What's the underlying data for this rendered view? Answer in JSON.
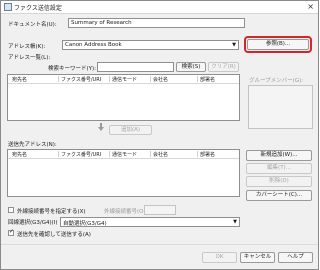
{
  "window": {
    "title": "ファクス送信設定"
  },
  "doc_name": {
    "label": "ドキュメント名(U):",
    "value": "Summary of Research"
  },
  "address_book": {
    "label": "アドレス帳(K):",
    "value": "Canon Address Book",
    "browse_label": "参照(B)..."
  },
  "address_list": {
    "label": "アドレス一覧(L):",
    "search_label": "検索キーワード(Y):",
    "search_value": "",
    "search_button": "検索(S)",
    "clear_button": "クリア(R)",
    "columns": [
      "宛先名",
      "ファクス番号/URI",
      "通信モード",
      "会社名",
      "部署名"
    ]
  },
  "group_members_label": "グループメンバー(G):",
  "add_button": "追加(A)",
  "recipients": {
    "label": "送信先アドレス(N):",
    "columns": [
      "宛先名",
      "ファクス番号/URI",
      "通信モード",
      "会社名",
      "部署名"
    ],
    "new_button": "新規追加(W)...",
    "edit_button": "編集(T)...",
    "delete_button": "削除(D)",
    "coversheet_button": "カバーシート(C)..."
  },
  "outside_line": {
    "label": "外線接続番号を指定する(X)",
    "number_label": "外線接続番号(O):",
    "checked": false
  },
  "line_select": {
    "label": "回線選択(G3/G4)(I)",
    "value": "自動選択(G3/G4)"
  },
  "confirm": {
    "label": "送信先を確認して送信する(A)",
    "checked": true
  },
  "footer": {
    "ok": "OK",
    "cancel": "キャンセル",
    "help": "ヘルプ"
  }
}
